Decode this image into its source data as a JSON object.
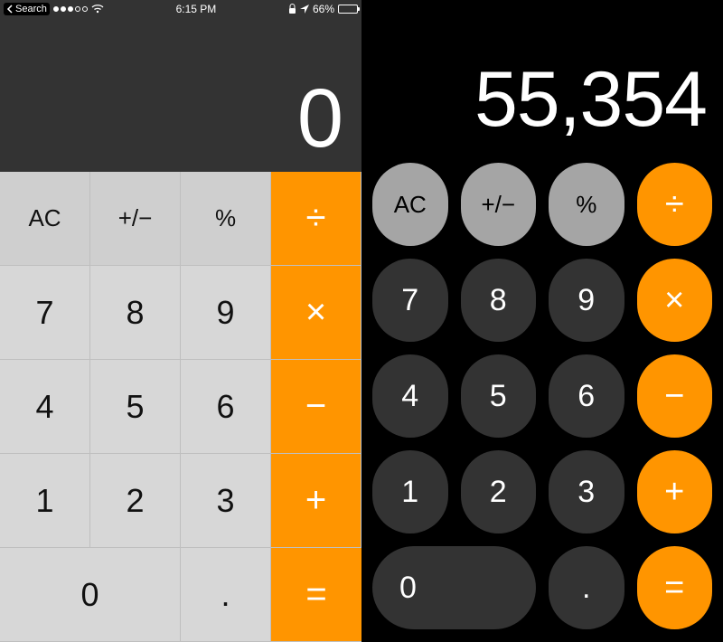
{
  "left": {
    "status": {
      "back_label": "Search",
      "time": "6:15 PM",
      "battery_pct": "66%",
      "battery_fill_pct": 66
    },
    "display": "0",
    "buttons": {
      "ac": "AC",
      "sign": "+/−",
      "percent": "%",
      "divide": "÷",
      "n7": "7",
      "n8": "8",
      "n9": "9",
      "multiply": "×",
      "n4": "4",
      "n5": "5",
      "n6": "6",
      "minus": "−",
      "n1": "1",
      "n2": "2",
      "n3": "3",
      "plus": "+",
      "n0": "0",
      "decimal": ".",
      "equals": "="
    }
  },
  "right": {
    "display": "55,354",
    "buttons": {
      "ac": "AC",
      "sign": "+/−",
      "percent": "%",
      "divide": "÷",
      "n7": "7",
      "n8": "8",
      "n9": "9",
      "multiply": "×",
      "n4": "4",
      "n5": "5",
      "n6": "6",
      "minus": "−",
      "n1": "1",
      "n2": "2",
      "n3": "3",
      "plus": "+",
      "n0": "0",
      "decimal": ".",
      "equals": "="
    }
  }
}
